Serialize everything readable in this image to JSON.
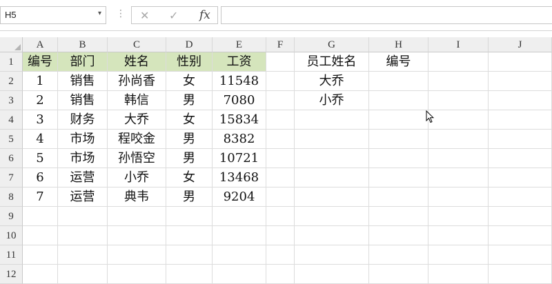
{
  "formula_bar": {
    "name_box": "H5",
    "cancel_icon": "✕",
    "enter_icon": "✓",
    "fx_label": "fx",
    "formula": ""
  },
  "columns": [
    "A",
    "B",
    "C",
    "D",
    "E",
    "F",
    "G",
    "H",
    "I",
    "J"
  ],
  "rows": [
    "1",
    "2",
    "3",
    "4",
    "5",
    "6",
    "7",
    "8",
    "9",
    "10",
    "11",
    "12"
  ],
  "table": {
    "headers": [
      "编号",
      "部门",
      "姓名",
      "性别",
      "工资"
    ],
    "records": [
      [
        "1",
        "销售",
        "孙尚香",
        "女",
        "11548"
      ],
      [
        "2",
        "销售",
        "韩信",
        "男",
        "7080"
      ],
      [
        "3",
        "财务",
        "大乔",
        "女",
        "15834"
      ],
      [
        "4",
        "市场",
        "程咬金",
        "男",
        "8382"
      ],
      [
        "5",
        "市场",
        "孙悟空",
        "男",
        "10721"
      ],
      [
        "6",
        "运营",
        "小乔",
        "女",
        "13468"
      ],
      [
        "7",
        "运营",
        "典韦",
        "男",
        "9204"
      ]
    ]
  },
  "lookup": {
    "headers": [
      "员工姓名",
      "编号"
    ],
    "names": [
      "大乔",
      "小乔"
    ]
  },
  "colors": {
    "header_fill": "#d5e5bc",
    "grid_line": "#dcdcdc"
  }
}
